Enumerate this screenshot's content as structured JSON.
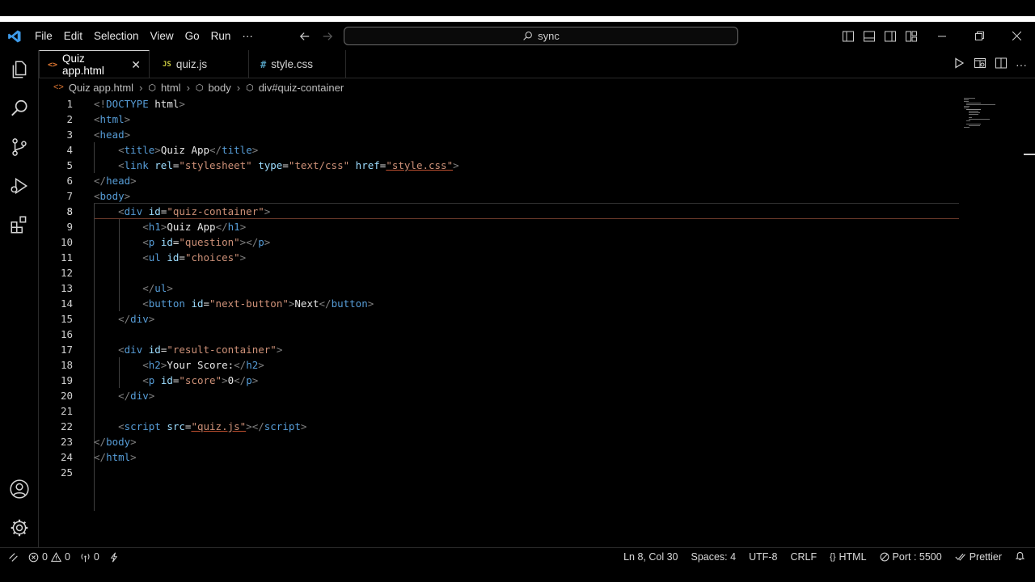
{
  "menu": [
    "File",
    "Edit",
    "Selection",
    "View",
    "Go",
    "Run",
    "···"
  ],
  "search": {
    "text": "sync"
  },
  "tabs": [
    {
      "label": "Quiz app.html",
      "icon": "<>",
      "active": true
    },
    {
      "label": "quiz.js",
      "icon": "JS",
      "active": false
    },
    {
      "label": "style.css",
      "icon": "#",
      "active": false
    }
  ],
  "breadcrumb": [
    "Quiz app.html",
    "html",
    "body",
    "div#quiz-container"
  ],
  "colors": {
    "html_icon": "#e37933",
    "js_icon": "#cbcb41",
    "css_icon": "#519aba",
    "vscode_blue": "#3e9ae8"
  },
  "code_lines": [
    {
      "n": "1"
    },
    {
      "n": "2"
    },
    {
      "n": "3"
    },
    {
      "n": "4"
    },
    {
      "n": "5"
    },
    {
      "n": "6"
    },
    {
      "n": "7"
    },
    {
      "n": "8"
    },
    {
      "n": "9"
    },
    {
      "n": "10"
    },
    {
      "n": "11"
    },
    {
      "n": "12"
    },
    {
      "n": "13"
    },
    {
      "n": "14"
    },
    {
      "n": "15"
    },
    {
      "n": "16"
    },
    {
      "n": "17"
    },
    {
      "n": "18"
    },
    {
      "n": "19"
    },
    {
      "n": "20"
    },
    {
      "n": "21"
    },
    {
      "n": "22"
    },
    {
      "n": "23"
    },
    {
      "n": "24"
    },
    {
      "n": "25"
    }
  ],
  "code_text": {
    "l1": {
      "a": "<!",
      "b": "DOCTYPE",
      "c": " html",
      ">": ">"
    },
    "l4_title": "Quiz App",
    "l5": {
      "rel": "\"stylesheet\"",
      "type": "\"text/css\"",
      "href": "\"style.css\""
    },
    "l8_id": "\"quiz-container\"",
    "l9_h1": "Quiz App",
    "l10_id": "\"question\"",
    "l11_id": "\"choices\"",
    "l14_id": "\"next-button\"",
    "l14_text": "Next",
    "l17_id": "\"result-container\"",
    "l18_h2": "Your Score:",
    "l19_id": "\"score\"",
    "l19_text": "0",
    "l22_src": "\"quiz.js\""
  },
  "status": {
    "errors": "0",
    "warnings": "0",
    "ports": "0",
    "position": "Ln 8, Col 30",
    "spaces": "Spaces: 4",
    "encoding": "UTF-8",
    "eol": "CRLF",
    "language": "HTML",
    "port": "Port : 5500",
    "formatter": "Prettier"
  }
}
